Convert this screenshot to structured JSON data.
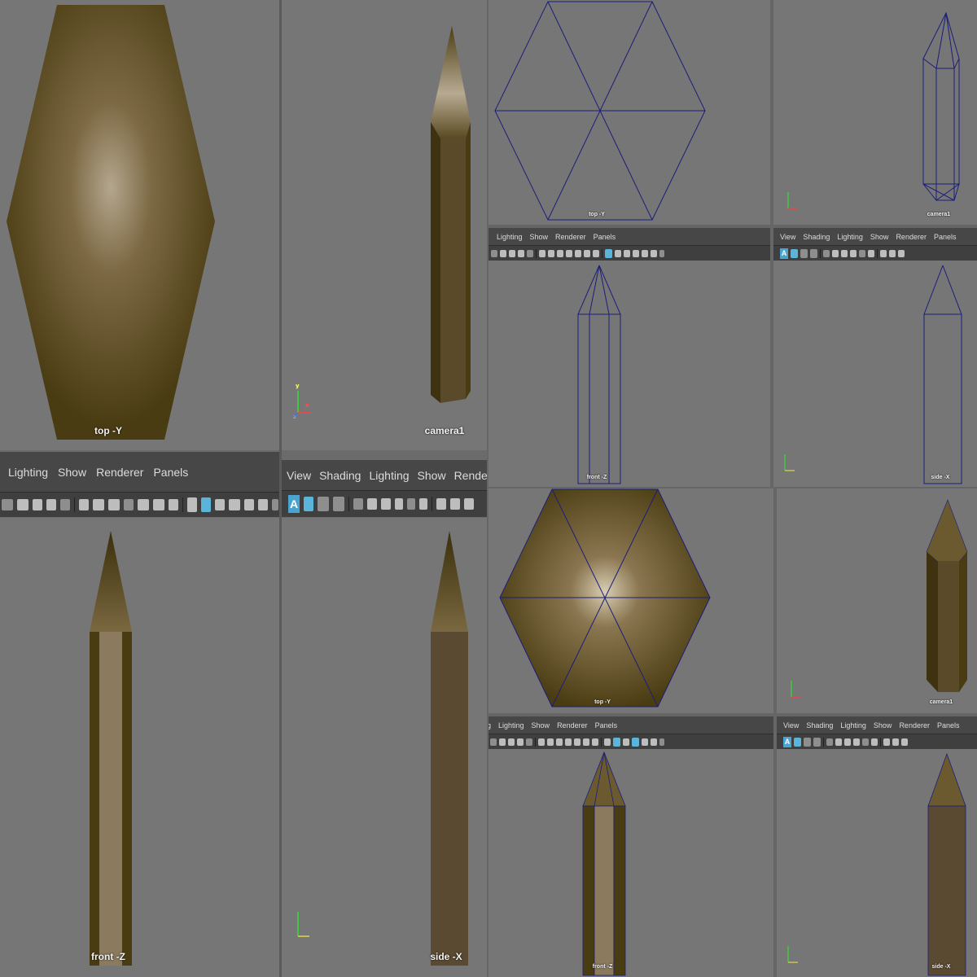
{
  "menus": {
    "full": [
      "View",
      "Shading",
      "Lighting",
      "Show",
      "Renderer",
      "Panels"
    ],
    "partial": [
      "Lighting",
      "Show",
      "Renderer",
      "Panels"
    ],
    "cut": [
      "g",
      "Lighting",
      "Show",
      "Renderer",
      "Panels"
    ]
  },
  "labels": {
    "top": "top -Y",
    "camera": "camera1",
    "front": "front -Z",
    "side": "side -X"
  },
  "axes": {
    "x": "x",
    "y": "y",
    "z": "z"
  },
  "toolbar_button": "A",
  "colors": {
    "viewport_bg": "#767676",
    "pencil_dark": "#4a3c12",
    "pencil_light": "#8b7a5e",
    "wireframe": "#1b1e7a",
    "highlight": "#5bb4d9"
  }
}
